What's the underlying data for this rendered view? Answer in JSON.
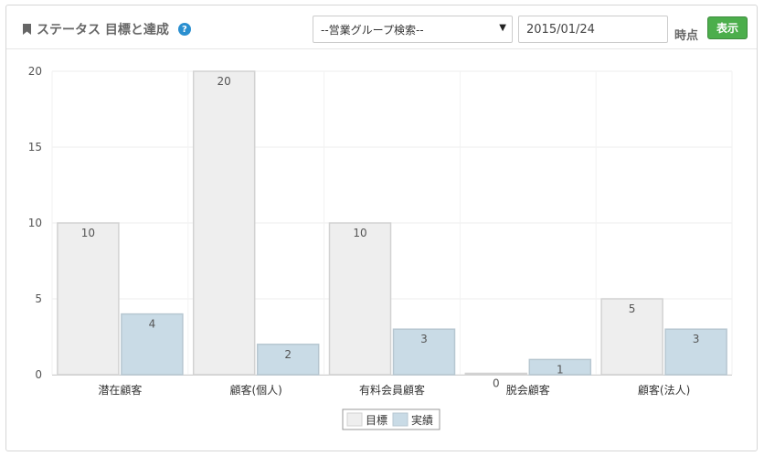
{
  "header": {
    "title": "ステータス 目標と達成",
    "help_symbol": "?",
    "group_select": "--営業グループ検索--",
    "date_value": "2015/01/24",
    "at_label": "時点",
    "show_button": "表示"
  },
  "colors": {
    "target": "#eeeeee",
    "target_border": "#d2d2d2",
    "actual": "#c9dbe6",
    "actual_border": "#b7c7d1",
    "button": "#4cae4c"
  },
  "chart_data": {
    "type": "bar",
    "categories": [
      "潜在顧客",
      "顧客(個人)",
      "有料会員顧客",
      "脱会顧客",
      "顧客(法人)"
    ],
    "series": [
      {
        "name": "目標",
        "values": [
          10,
          20,
          10,
          0,
          5
        ]
      },
      {
        "name": "実績",
        "values": [
          4,
          2,
          3,
          1,
          3
        ]
      }
    ],
    "ylim": [
      0,
      20
    ],
    "yticks": [
      "0",
      "5",
      "10",
      "15",
      "20"
    ],
    "grid": true,
    "legend": "bottom-center",
    "data_labels": true
  }
}
